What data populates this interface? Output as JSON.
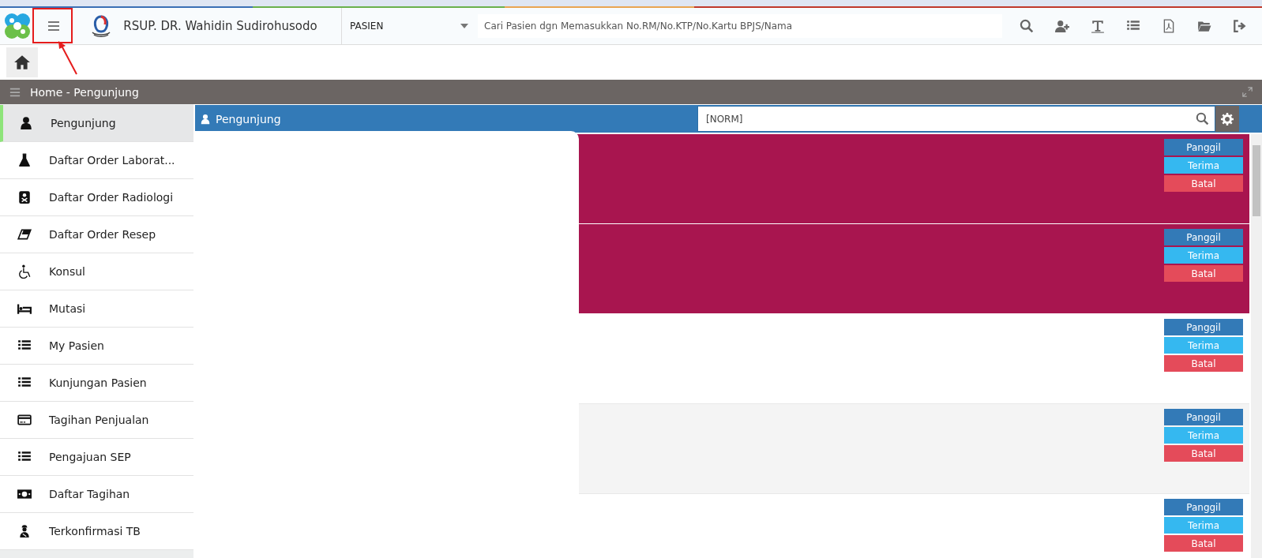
{
  "header": {
    "title": "RSUP. DR. Wahidin Sudirohusodo",
    "category": "PASIEN",
    "search": {
      "placeholder": "Cari Pasien dgn Memasukkan No.RM/No.KTP/No.Kartu BPJS/Nama"
    }
  },
  "breadcrumb": {
    "title": "Home - Pengunjung"
  },
  "sidebar": {
    "items": [
      {
        "label": "Pengunjung",
        "selected": true
      },
      {
        "label": "Daftar Order Laborat...",
        "selected": false
      },
      {
        "label": "Daftar Order Radiologi",
        "selected": false
      },
      {
        "label": "Daftar Order Resep",
        "selected": false
      },
      {
        "label": "Konsul",
        "selected": false
      },
      {
        "label": "Mutasi",
        "selected": false
      },
      {
        "label": "My Pasien",
        "selected": false
      },
      {
        "label": "Kunjungan Pasien",
        "selected": false
      },
      {
        "label": "Tagihan Penjualan",
        "selected": false
      },
      {
        "label": "Pengajuan SEP",
        "selected": false
      },
      {
        "label": "Daftar Tagihan",
        "selected": false
      },
      {
        "label": "Terkonfirmasi TB",
        "selected": false
      }
    ]
  },
  "panel": {
    "title": "Pengunjung",
    "search": {
      "value": "[NORM]"
    },
    "rows": [
      {
        "color": "#a8154f",
        "buttons": [
          {
            "kind": "call",
            "label": "Panggil"
          },
          {
            "kind": "accept",
            "label": "Terima"
          },
          {
            "kind": "cancel",
            "label": "Batal"
          }
        ]
      },
      {
        "color": "#a8154f",
        "buttons": [
          {
            "kind": "call",
            "label": "Panggil"
          },
          {
            "kind": "accept",
            "label": "Terima"
          },
          {
            "kind": "cancel",
            "label": "Batal"
          }
        ]
      },
      {
        "color": "#ffffff",
        "buttons": [
          {
            "kind": "call",
            "label": "Panggil"
          },
          {
            "kind": "accept",
            "label": "Terima"
          },
          {
            "kind": "cancel",
            "label": "Batal"
          }
        ]
      },
      {
        "color": "#f4f4f4",
        "buttons": [
          {
            "kind": "call",
            "label": "Panggil"
          },
          {
            "kind": "accept",
            "label": "Terima"
          },
          {
            "kind": "cancel",
            "label": "Batal"
          }
        ]
      },
      {
        "color": "#ffffff",
        "buttons": [
          {
            "kind": "call",
            "label": "Panggil"
          },
          {
            "kind": "accept",
            "label": "Terima"
          },
          {
            "kind": "cancel",
            "label": "Batal"
          }
        ]
      }
    ]
  }
}
